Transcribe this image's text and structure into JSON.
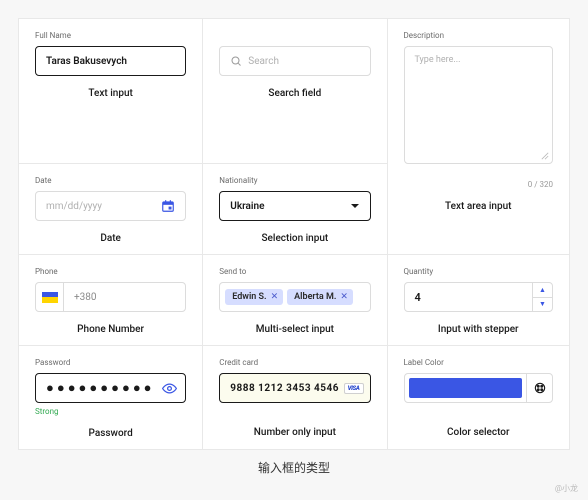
{
  "fields": {
    "fullname": {
      "label": "Full Name",
      "value": "Taras Bakusevych",
      "caption": "Text input"
    },
    "search": {
      "placeholder": "Search",
      "caption": "Search field"
    },
    "description": {
      "label": "Description",
      "placeholder": "Type here...",
      "charcount": "0 / 320",
      "caption": "Text area input"
    },
    "date": {
      "label": "Date",
      "placeholder": "mm/dd/yyyy",
      "caption": "Date"
    },
    "nationality": {
      "label": "Nationality",
      "value": "Ukraine",
      "caption": "Selection input"
    },
    "phone": {
      "label": "Phone",
      "value": "+380",
      "caption": "Phone Number"
    },
    "sendto": {
      "label": "Send to",
      "chips": [
        "Edwin S.",
        "Alberta M."
      ],
      "caption": "Multi-select input"
    },
    "quantity": {
      "label": "Quantity",
      "value": "4",
      "caption": "Input with stepper"
    },
    "password": {
      "label": "Password",
      "masked": "●●●●●●●●●●",
      "strength": "Strong",
      "caption": "Password"
    },
    "creditcard": {
      "label": "Credit card",
      "value": "9888  1212  3453  4546",
      "brand": "VISA",
      "caption": "Number only input"
    },
    "color": {
      "label": "Label Color",
      "swatch": "#3a56e4",
      "caption": "Color selector"
    }
  },
  "footer": {
    "title": "输入框的类型",
    "attribution": "@小龙"
  }
}
